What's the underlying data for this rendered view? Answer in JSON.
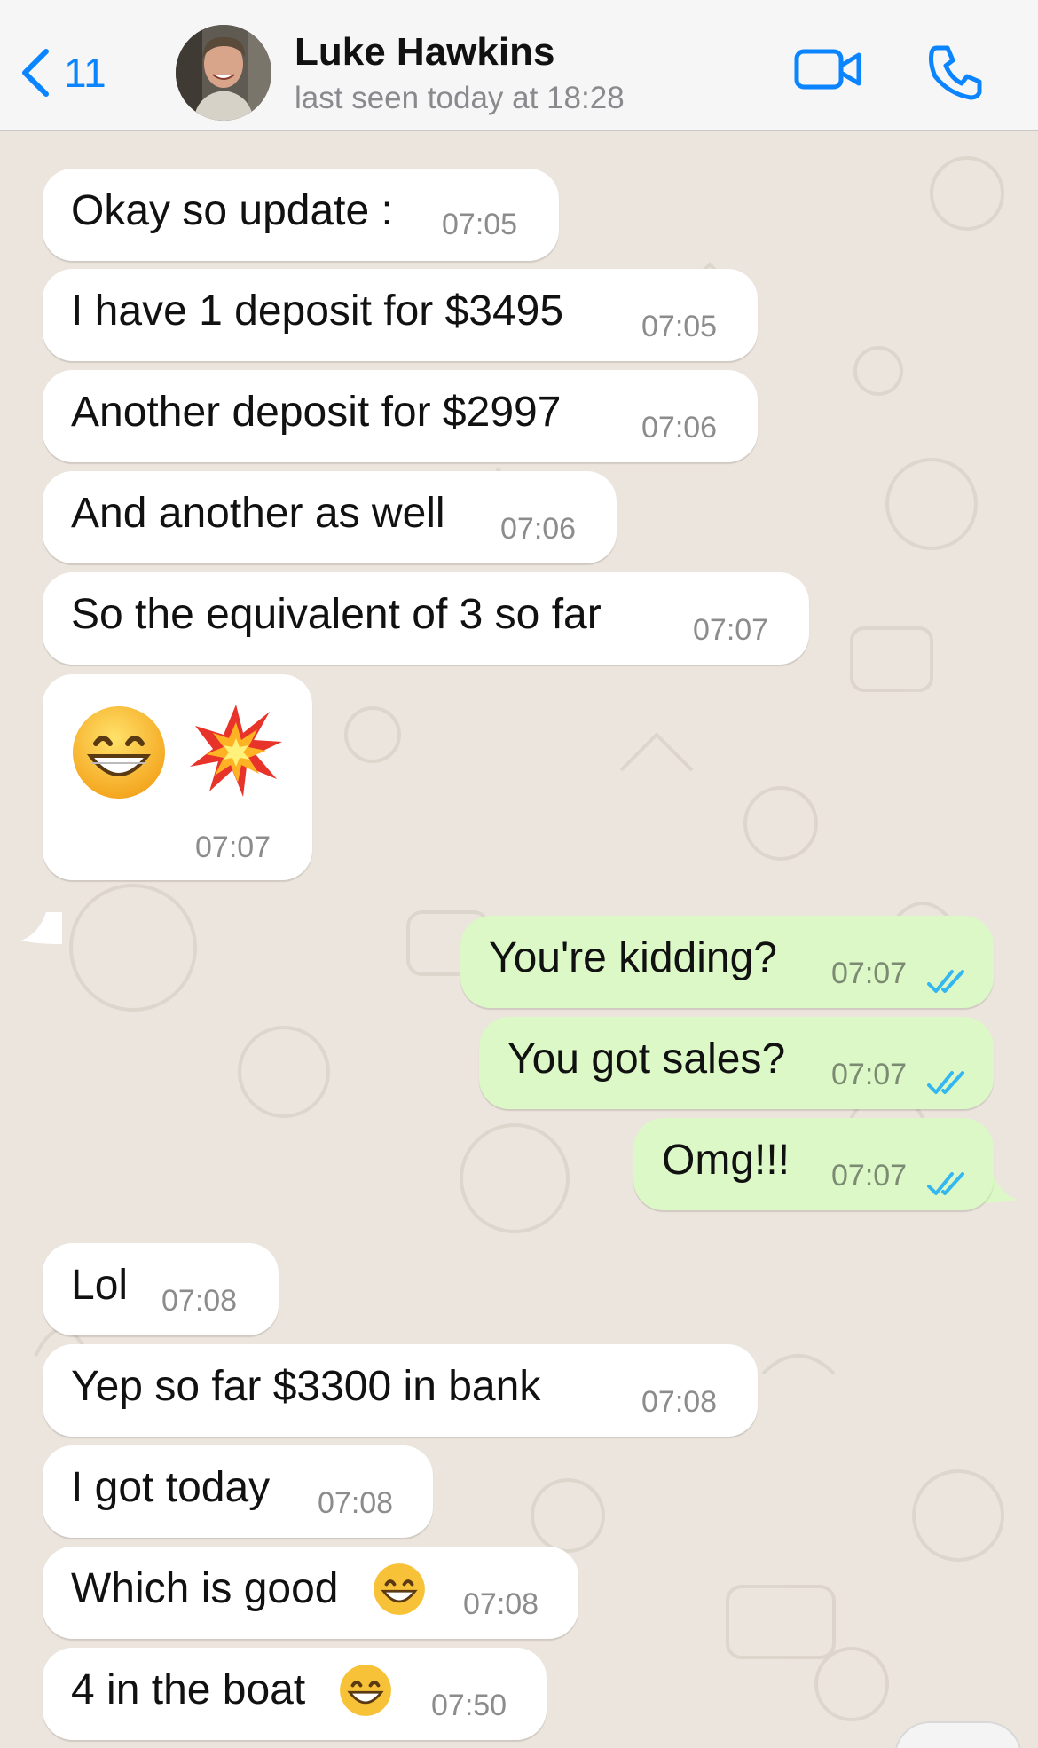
{
  "header": {
    "back_count": "11",
    "contact_name": "Luke Hawkins",
    "status": "last seen today at 18:28",
    "back_icon": "chevron-left-icon",
    "video_icon": "video-camera-icon",
    "call_icon": "phone-icon",
    "accent_color": "#0a84ff"
  },
  "messages": [
    {
      "dir": "in",
      "text": "Okay so update :",
      "time": "07:05"
    },
    {
      "dir": "in",
      "text": "I have 1 deposit for $3495",
      "time": "07:05"
    },
    {
      "dir": "in",
      "text": "Another deposit for $2997",
      "time": "07:06"
    },
    {
      "dir": "in",
      "text": "And another as well",
      "time": "07:06"
    },
    {
      "dir": "in",
      "text": "So the equivalent of 3 so far",
      "time": "07:07"
    },
    {
      "dir": "in",
      "text": "",
      "emojis": [
        "grinning-face-icon",
        "collision-icon"
      ],
      "time": "07:07"
    },
    {
      "dir": "out",
      "text": "You're kidding?",
      "time": "07:07",
      "status": "read-ticks-icon"
    },
    {
      "dir": "out",
      "text": "You got sales?",
      "time": "07:07",
      "status": "read-ticks-icon"
    },
    {
      "dir": "out",
      "text": "Omg!!!",
      "time": "07:07",
      "status": "read-ticks-icon"
    },
    {
      "dir": "in",
      "text": "Lol",
      "time": "07:08"
    },
    {
      "dir": "in",
      "text": "Yep so far $3300 in bank",
      "time": "07:08"
    },
    {
      "dir": "in",
      "text": "I got today",
      "time": "07:08"
    },
    {
      "dir": "in",
      "text": "Which is good",
      "emojis": [
        "grinning-face-icon"
      ],
      "time": "07:08"
    },
    {
      "dir": "in",
      "text": "4 in the boat",
      "emojis": [
        "grinning-face-icon"
      ],
      "time": "07:50"
    }
  ],
  "colors": {
    "incoming_bubble": "#ffffff",
    "outgoing_bubble": "#dbf8c6",
    "chat_background": "#ece5dd",
    "read_ticks": "#34b7f1"
  }
}
